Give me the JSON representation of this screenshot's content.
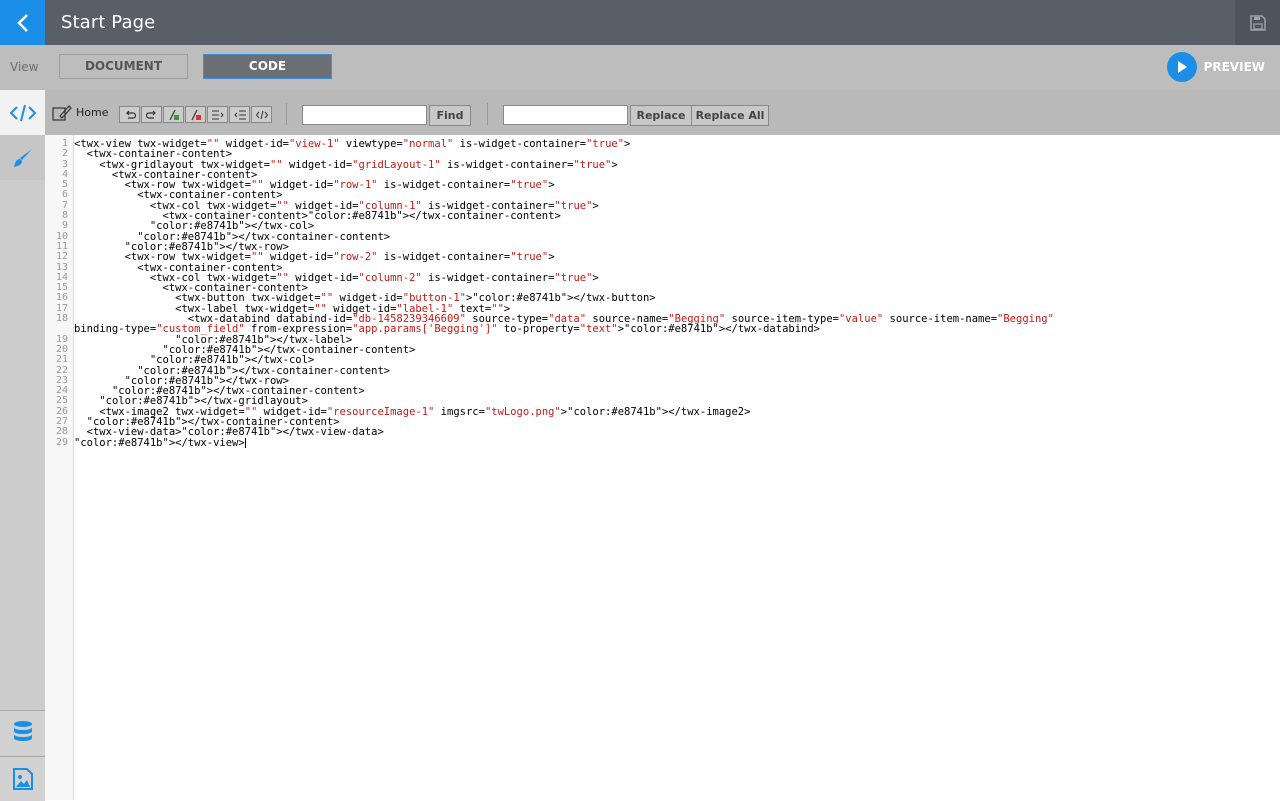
{
  "header": {
    "title": "Start Page"
  },
  "view_bar": {
    "label": "View",
    "tabs": [
      {
        "label": "DOCUMENT"
      },
      {
        "label": "CODE",
        "active": true
      }
    ],
    "preview_label": "PREVIEW"
  },
  "toolbar": {
    "home_label": "Home",
    "find_value": "",
    "find_label": "Find",
    "replace_value": "",
    "replace_label": "Replace",
    "replace_all_label": "Replace All"
  },
  "sidebar": {
    "items": [
      "code-editor",
      "style-brush",
      "data",
      "media"
    ]
  },
  "colors": {
    "accent": "#1b8ee8",
    "topbar": "#5a5e66",
    "viewbar": "#bdbdbd",
    "code_string": "#c41a16",
    "code_closing_tag": "#e8741b"
  },
  "code": {
    "lines": [
      "<twx-view twx-widget=\"\" widget-id=\"view-1\" viewtype=\"normal\" is-widget-container=\"true\">",
      "  <twx-container-content>",
      "    <twx-gridlayout twx-widget=\"\" widget-id=\"gridLayout-1\" is-widget-container=\"true\">",
      "      <twx-container-content>",
      "        <twx-row twx-widget=\"\" widget-id=\"row-1\" is-widget-container=\"true\">",
      "          <twx-container-content>",
      "            <twx-col twx-widget=\"\" widget-id=\"column-1\" is-widget-container=\"true\">",
      "              <twx-container-content></twx-container-content>",
      "            </twx-col>",
      "          </twx-container-content>",
      "        </twx-row>",
      "        <twx-row twx-widget=\"\" widget-id=\"row-2\" is-widget-container=\"true\">",
      "          <twx-container-content>",
      "            <twx-col twx-widget=\"\" widget-id=\"column-2\" is-widget-container=\"true\">",
      "              <twx-container-content>",
      "                <twx-button twx-widget=\"\" widget-id=\"button-1\"></twx-button>",
      "                <twx-label twx-widget=\"\" widget-id=\"label-1\" text=\"\">",
      "                  <twx-databind databind-id=\"db-1458239346609\" source-type=\"data\" source-name=\"Begging\" source-item-type=\"value\" source-item-name=\"Begging\"\nbinding-type=\"custom_field\" from-expression=\"app.params['Begging']\" to-property=\"text\"></twx-databind>",
      "                </twx-label>",
      "              </twx-container-content>",
      "            </twx-col>",
      "          </twx-container-content>",
      "        </twx-row>",
      "      </twx-container-content>",
      "    </twx-gridlayout>",
      "    <twx-image2 twx-widget=\"\" widget-id=\"resourceImage-1\" imgsrc=\"twLogo.png\"></twx-image2>",
      "  </twx-container-content>",
      "  <twx-view-data></twx-view-data>",
      "</twx-view>"
    ]
  }
}
